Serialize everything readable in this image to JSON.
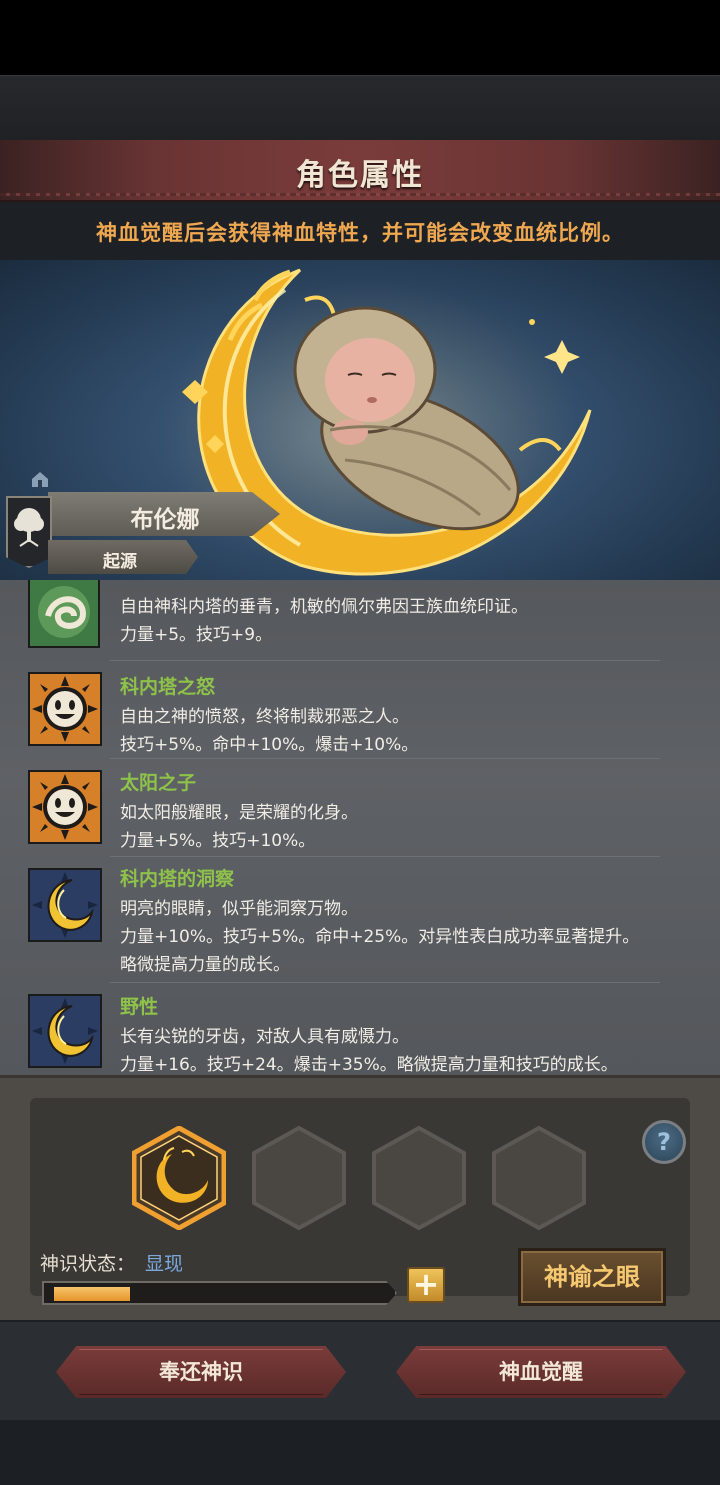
{
  "header": {
    "title": "角色属性",
    "subtitle": "神血觉醒后会获得神血特性，并可能会改变血统比例。"
  },
  "character": {
    "name": "布伦娜",
    "origin_label": "起源"
  },
  "traits": [
    {
      "name": "",
      "desc": "自由神科内塔的垂青，机敏的佩尔弗因王族血统印证。",
      "stats": [
        "力量+5。技巧+9。"
      ],
      "icon": "wind-swirl-icon"
    },
    {
      "name": "科内塔之怒",
      "desc": "自由之神的愤怒，终将制裁邪恶之人。",
      "stats": [
        "技巧+5%。命中+10%。爆击+10%。"
      ],
      "icon": "sun-face-icon"
    },
    {
      "name": "太阳之子",
      "desc": "如太阳般耀眼，是荣耀的化身。",
      "stats": [
        "力量+5%。技巧+10%。"
      ],
      "icon": "sun-face-icon"
    },
    {
      "name": "科内塔的洞察",
      "desc": "明亮的眼睛，似乎能洞察万物。",
      "stats": [
        "力量+10%。技巧+5%。命中+25%。对异性表白成功率显著提升。",
        "略微提高力量的成长。"
      ],
      "icon": "crescent-moon-icon"
    },
    {
      "name": "野性",
      "desc": "长有尖锐的牙齿，对敌人具有威慑力。",
      "stats": [
        "力量+16。技巧+24。爆击+35%。略微提高力量和技巧的成长。"
      ],
      "icon": "crescent-moon-icon"
    }
  ],
  "divine": {
    "status_label": "神识状态：",
    "status_value": "显现",
    "progress": 0.23,
    "plus_label": "+",
    "oracle_button": "神谕之眼",
    "help_label": "?"
  },
  "actions": {
    "return_button": "奉还神识",
    "awaken_button": "神血觉醒"
  },
  "colors": {
    "accent_orange": "#f0a850",
    "trait_name_green": "#8ec24a",
    "status_blue": "#7aa8dd",
    "title_red": "#7a3c3a"
  }
}
